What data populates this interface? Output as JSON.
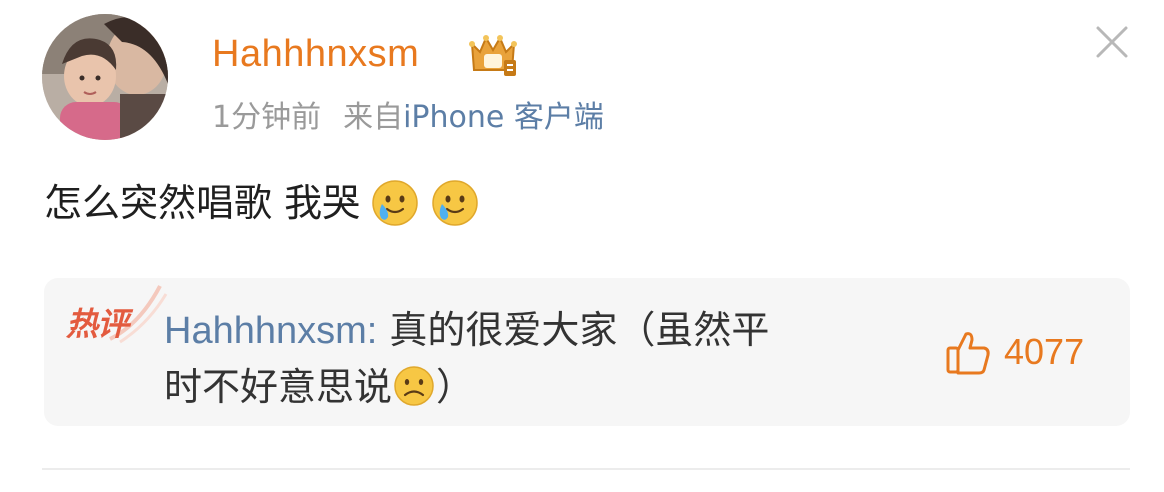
{
  "post": {
    "username": "Hahhhnxsm",
    "time": "1分钟前",
    "source_prefix": "来自",
    "source": "iPhone 客户端",
    "text": "怎么突然唱歌 我哭",
    "emojis": [
      "crying-smile-emoji",
      "crying-smile-emoji"
    ],
    "badge_icon": "crown-badge-icon",
    "close_icon": "close-icon"
  },
  "hot_comment": {
    "tag": "热评",
    "author": "Hahhhnxsm:",
    "text_line1": " 真的很爱大家（虽然平",
    "text_line2": "时不好意思说",
    "text_after_emoji": "）",
    "emoji": "sad-face-emoji",
    "like_icon": "thumbs-up-icon",
    "like_count": "4077"
  },
  "colors": {
    "username": "#e8791f",
    "link": "#5c7ea6",
    "meta": "#9a9a9a",
    "hot_tag": "#e35b3f",
    "hot_bg": "#f6f6f6",
    "like": "#e8791f"
  }
}
